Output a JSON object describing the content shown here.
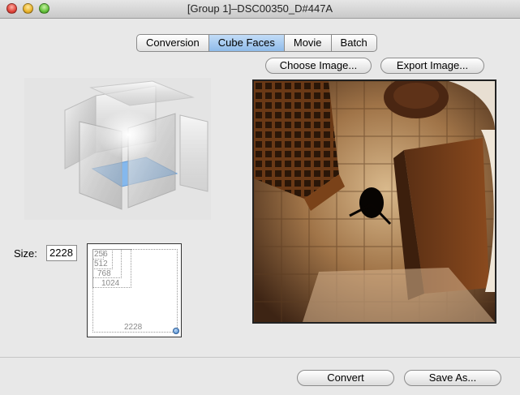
{
  "window": {
    "title": "[Group 1]–DSC00350_D#447A"
  },
  "tabs": [
    {
      "label": "Conversion"
    },
    {
      "label": "Cube Faces"
    },
    {
      "label": "Movie"
    },
    {
      "label": "Batch"
    }
  ],
  "active_tab": "Cube Faces",
  "buttons": {
    "choose_image": "Choose Image...",
    "export_image": "Export Image...",
    "convert": "Convert",
    "save_as": "Save As..."
  },
  "size": {
    "label": "Size:",
    "value": "2228"
  },
  "size_preview": {
    "labels": [
      "256",
      "512",
      "768",
      "1024",
      "2228"
    ]
  },
  "colors": {
    "active_tab": "#9cc4ee",
    "accent": "#6aa8e8"
  }
}
